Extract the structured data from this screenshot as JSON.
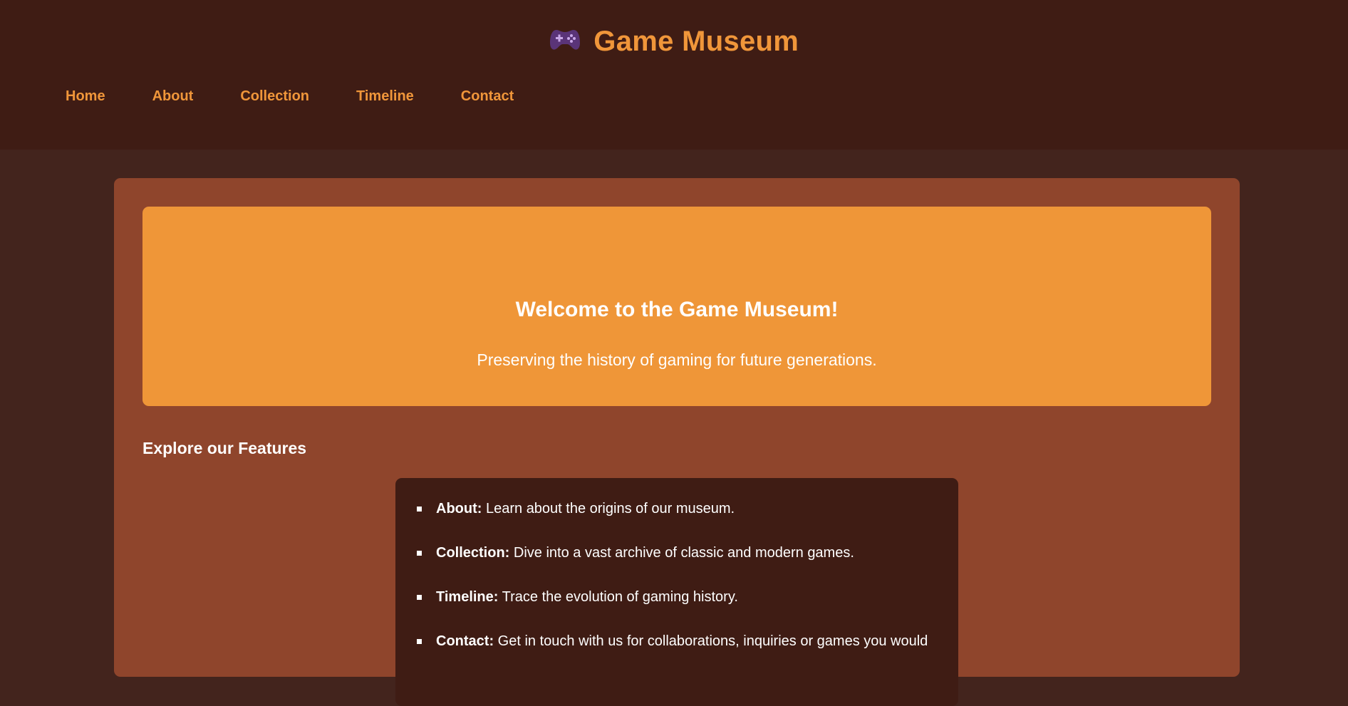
{
  "header": {
    "logo_icon": "game-controller-icon",
    "title": "Game Museum",
    "nav": [
      {
        "label": "Home"
      },
      {
        "label": "About"
      },
      {
        "label": "Collection"
      },
      {
        "label": "Timeline"
      },
      {
        "label": "Contact"
      }
    ]
  },
  "hero": {
    "title": "Welcome to the Game Museum!",
    "subtitle": "Preserving the history of gaming for future generations."
  },
  "features": {
    "heading": "Explore our Features",
    "items": [
      {
        "name": "About:",
        "description": " Learn about the origins of our museum."
      },
      {
        "name": "Collection:",
        "description": " Dive into a vast archive of classic and modern games."
      },
      {
        "name": "Timeline:",
        "description": " Trace the evolution of gaming history."
      },
      {
        "name": "Contact:",
        "description": " Get in touch with us for collaborations, inquiries or games you would"
      }
    ]
  },
  "colors": {
    "header_bg": "#3f1c14",
    "page_bg": "#43241d",
    "card_bg": "#8f452c",
    "accent": "#f0963a",
    "hero_bg": "#ef9638",
    "features_bg": "#3f1c14"
  }
}
